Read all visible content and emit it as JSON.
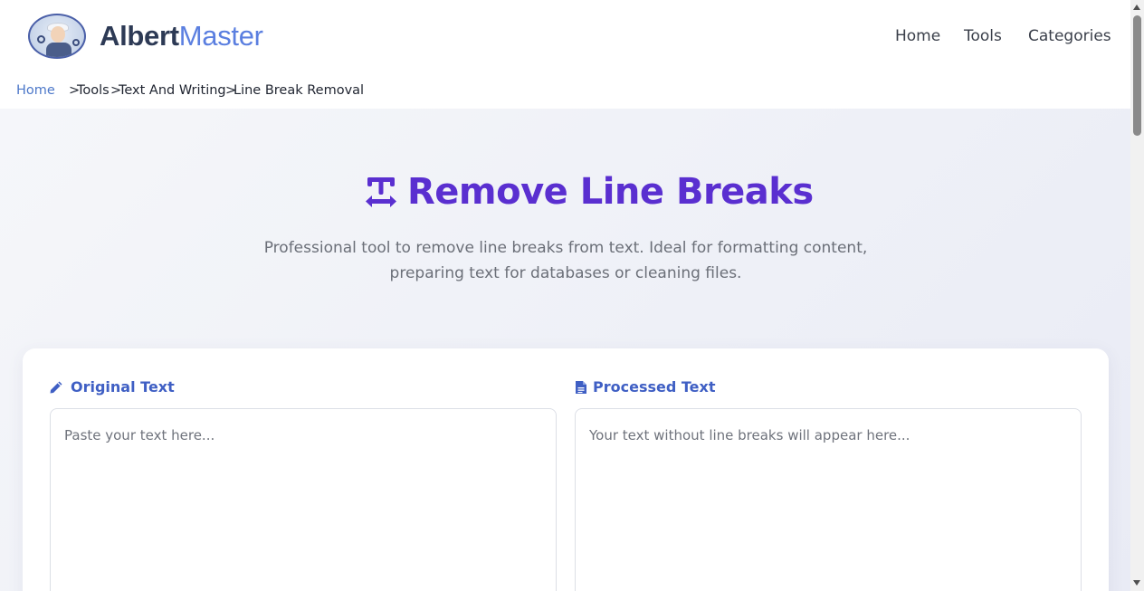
{
  "header": {
    "brand_part1": "Albert",
    "brand_part2": "Master",
    "nav": [
      {
        "label": "Home"
      },
      {
        "label": "Tools"
      },
      {
        "label": "Categories"
      }
    ]
  },
  "breadcrumb": {
    "home": "Home",
    "sep": ">",
    "items": [
      "Tools",
      "Text And Writing",
      "Line Break Removal"
    ]
  },
  "hero": {
    "icon": "text-height-icon",
    "title": "Remove Line Breaks",
    "description": "Professional tool to remove line breaks from text. Ideal for formatting content, preparing text for databases or cleaning files."
  },
  "editor": {
    "original_label": "Original Text",
    "original_icon": "pencil-icon",
    "original_placeholder": "Paste your text here...",
    "processed_label": "Processed Text",
    "processed_icon": "file-text-icon",
    "processed_placeholder": "Your text without line breaks will appear here..."
  },
  "colors": {
    "accent": "#5a2fd0",
    "link": "#4d78c9",
    "label": "#3f5fc4",
    "brand_dark": "#2d3a55",
    "brand_light": "#5b7fe0"
  }
}
